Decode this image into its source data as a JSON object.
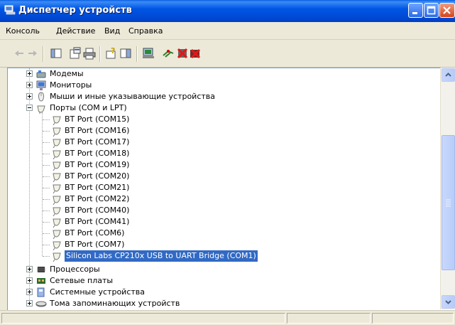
{
  "window": {
    "title": "Диспетчер устройств"
  },
  "menu": [
    "Консоль",
    "Действие",
    "Вид",
    "Справка"
  ],
  "toolbar": {
    "icons": [
      "back-icon",
      "forward-icon",
      "console-tree-icon",
      "properties-icon",
      "print-icon",
      "help-icon",
      "view-icon",
      "scan-hardware-icon",
      "update-driver-icon",
      "disable-device-icon",
      "uninstall-device-icon"
    ]
  },
  "tree": {
    "categories_top": [
      {
        "label": "Модемы",
        "icon": "modem-icon",
        "expanded": false
      },
      {
        "label": "Мониторы",
        "icon": "monitor-icon",
        "expanded": false
      },
      {
        "label": "Мыши и иные указывающие устройства",
        "icon": "mouse-icon",
        "expanded": false
      },
      {
        "label": "Порты (COM и LPT)",
        "icon": "port-icon",
        "expanded": true
      }
    ],
    "ports": [
      "BT Port (COM15)",
      "BT Port (COM16)",
      "BT Port (COM17)",
      "BT Port (COM18)",
      "BT Port (COM19)",
      "BT Port (COM20)",
      "BT Port (COM21)",
      "BT Port (COM22)",
      "BT Port (COM40)",
      "BT Port (COM41)",
      "BT Port (COM6)",
      "BT Port (COM7)",
      "Silicon Labs CP210x USB to UART Bridge (COM1)"
    ],
    "selected_port": "Silicon Labs CP210x USB to UART Bridge (COM1)",
    "categories_bottom": [
      {
        "label": "Процессоры",
        "icon": "processor-icon",
        "expanded": false
      },
      {
        "label": "Сетевые платы",
        "icon": "network-card-icon",
        "expanded": false
      },
      {
        "label": "Системные устройства",
        "icon": "system-device-icon",
        "expanded": false
      },
      {
        "label": "Тома запоминающих устройств",
        "icon": "storage-volume-icon",
        "expanded": false
      }
    ]
  },
  "colors": {
    "titlebar": "#0055e5",
    "selection": "#316ac5",
    "chrome": "#ece9d8"
  }
}
